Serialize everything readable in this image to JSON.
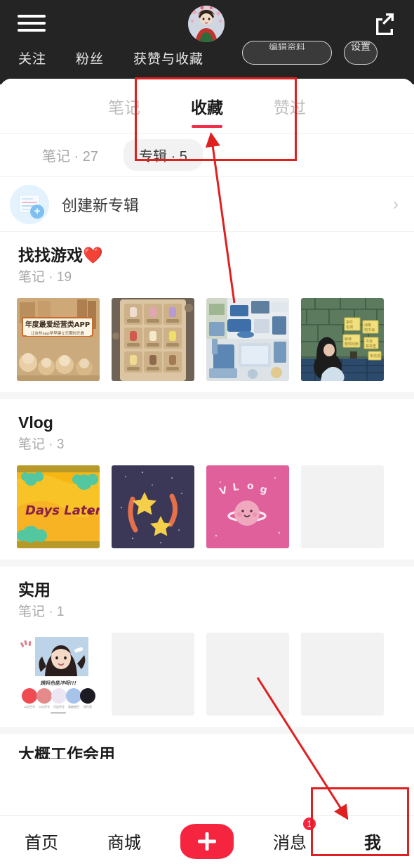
{
  "header": {
    "menu_icon": "hamburger-menu-icon",
    "avatar_icon": "user-avatar",
    "share_icon": "share-external-icon",
    "stats": [
      {
        "label": "关注"
      },
      {
        "label": "粉丝"
      },
      {
        "label": "获赞与收藏"
      }
    ],
    "edit_button_label": "编辑资料",
    "settings_button_label": "设置"
  },
  "tabs": [
    {
      "label": "笔记",
      "active": false
    },
    {
      "label": "收藏",
      "active": true
    },
    {
      "label": "赞过",
      "active": false
    }
  ],
  "filters": [
    {
      "label": "笔记 · 27",
      "active": false
    },
    {
      "label": "专辑 · 5",
      "active": true
    }
  ],
  "create_album": {
    "label": "创建新专辑",
    "icon": "create-album-icon",
    "chevron": "›"
  },
  "albums": [
    {
      "title": "找找游戏❤️",
      "subtitle": "笔记 · 19",
      "thumbnails": [
        {
          "name": "thumb-game-app-poster",
          "caption": "年度最爱经营类APP",
          "caption_sub": "让这些app早早建立无期时光看",
          "kind": "illustration-warm"
        },
        {
          "name": "thumb-drink-grid",
          "kind": "drink-grid"
        },
        {
          "name": "thumb-room-isometric",
          "kind": "room-blue"
        },
        {
          "name": "thumb-girl-wall-notes",
          "kind": "wall-notes"
        }
      ]
    },
    {
      "title": "Vlog",
      "subtitle": "笔记 · 3",
      "thumbnails": [
        {
          "name": "thumb-days-later",
          "caption": "Days Later .",
          "kind": "yellow-days"
        },
        {
          "name": "thumb-stars-night",
          "kind": "night-stars"
        },
        {
          "name": "thumb-vlog-planet",
          "caption": "V L o g",
          "kind": "pink-vlog"
        },
        {
          "name": "thumb-empty",
          "kind": "empty"
        }
      ]
    },
    {
      "title": "实用",
      "subtitle": "笔记 · 1",
      "thumbnails": [
        {
          "name": "thumb-makeup-palette",
          "kind": "makeup"
        },
        {
          "name": "thumb-empty",
          "kind": "empty"
        },
        {
          "name": "thumb-empty",
          "kind": "empty"
        },
        {
          "name": "thumb-empty",
          "kind": "empty"
        }
      ]
    }
  ],
  "clipped_album": {
    "title": "大概工作会用"
  },
  "bottom_nav": [
    {
      "label": "首页",
      "name": "nav-home",
      "active": false
    },
    {
      "label": "商城",
      "name": "nav-shop",
      "active": false
    },
    {
      "label": "消息",
      "name": "nav-messages",
      "active": false,
      "badge": "1"
    },
    {
      "label": "我",
      "name": "nav-me",
      "active": true
    }
  ],
  "bottom_nav_plus": {
    "label": "+",
    "name": "nav-create-button"
  },
  "annotations": {
    "box_top": "highlight-collection-tab",
    "box_bottom": "highlight-me-tab",
    "arrow_top": "arrow-to-collection-tab",
    "arrow_bottom": "arrow-to-me-tab",
    "color": "#e02020"
  },
  "colors": {
    "brand_red": "#f5253f",
    "tab_underline": "#f0304b",
    "header_dark": "#242424",
    "annotation_red": "#e02020"
  }
}
